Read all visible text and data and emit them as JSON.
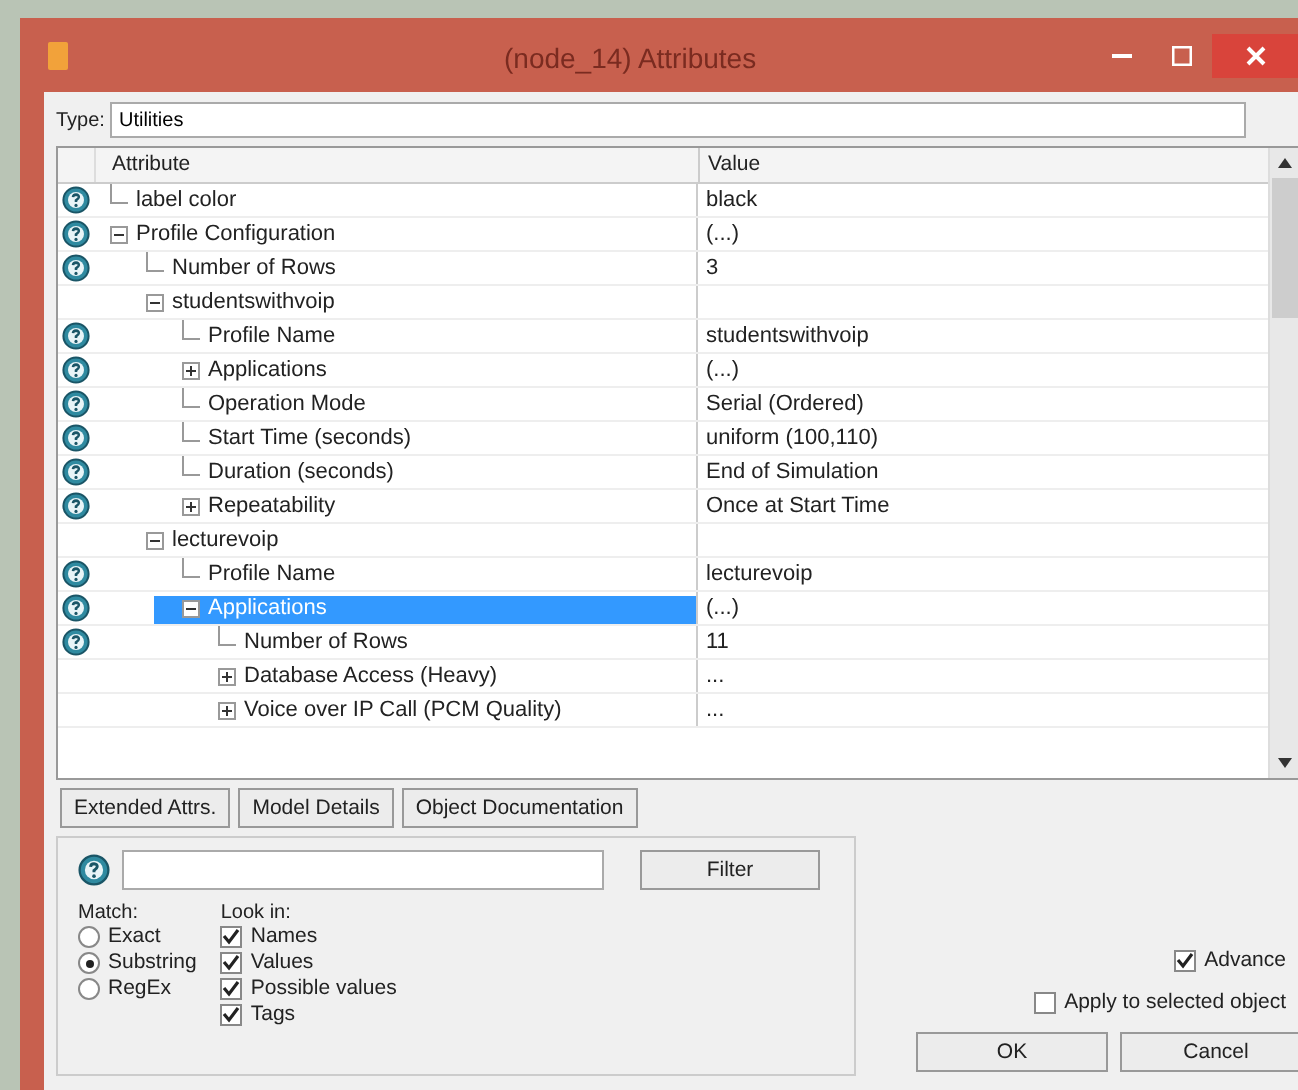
{
  "window": {
    "title": "(node_14) Attributes"
  },
  "type_field": {
    "label": "Type:",
    "value": "Utilities"
  },
  "table": {
    "columns": [
      "Attribute",
      "Value"
    ],
    "rows": [
      {
        "name": "label color",
        "value": "black",
        "help": true,
        "selected": false
      },
      {
        "name": "Profile Configuration",
        "value": "(...)",
        "help": true,
        "expanded": true,
        "selected": false,
        "children": [
          {
            "name": "Number of Rows",
            "value": "3",
            "help": true,
            "selected": false
          },
          {
            "name": "studentswithvoip",
            "help": false,
            "expanded": true,
            "selected": false,
            "children": [
              {
                "name": "Profile Name",
                "value": "studentswithvoip",
                "help": true,
                "selected": false
              },
              {
                "name": "Applications",
                "value": "(...)",
                "help": true,
                "expanded": false,
                "selected": false
              },
              {
                "name": "Operation Mode",
                "value": "Serial (Ordered)",
                "help": true,
                "selected": false
              },
              {
                "name": "Start Time (seconds)",
                "value": "uniform (100,110)",
                "help": true,
                "selected": false
              },
              {
                "name": "Duration (seconds)",
                "value": "End of Simulation",
                "help": true,
                "selected": false
              },
              {
                "name": "Repeatability",
                "value": "Once at Start Time",
                "help": true,
                "expanded": false,
                "selected": false
              }
            ]
          },
          {
            "name": "lecturevoip",
            "help": false,
            "expanded": true,
            "selected": false,
            "children": [
              {
                "name": "Profile Name",
                "value": "lecturevoip",
                "help": true,
                "selected": false
              },
              {
                "name": "Applications",
                "value": "(...)",
                "help": true,
                "expanded": true,
                "selected": true,
                "children": [
                  {
                    "name": "Number of Rows",
                    "value": "11",
                    "help": true,
                    "selected": false
                  },
                  {
                    "name": "Database Access (Heavy)",
                    "value": "...",
                    "help": false,
                    "expanded": false,
                    "selected": false
                  },
                  {
                    "name": "Voice over IP Call (PCM Quality)",
                    "value": "...",
                    "help": false,
                    "expanded": false,
                    "selected": false
                  }
                ]
              }
            ]
          }
        ]
      }
    ]
  },
  "tab_buttons": [
    "Extended Attrs.",
    "Model Details",
    "Object Documentation"
  ],
  "filter": {
    "button": "Filter",
    "match_label": "Match:",
    "match": [
      {
        "label": "Exact",
        "selected": false
      },
      {
        "label": "Substring",
        "selected": true
      },
      {
        "label": "RegEx",
        "selected": false
      }
    ],
    "look_label": "Look in:",
    "look_in": [
      {
        "label": "Names",
        "checked": true
      },
      {
        "label": "Values",
        "checked": true
      },
      {
        "label": "Possible values",
        "checked": true
      },
      {
        "label": "Tags",
        "checked": true
      }
    ]
  },
  "advanced": {
    "label": "Advance",
    "checked": true
  },
  "apply_selected": {
    "label": "Apply to selected object",
    "checked": false
  },
  "buttons": [
    "OK",
    "Cancel"
  ]
}
